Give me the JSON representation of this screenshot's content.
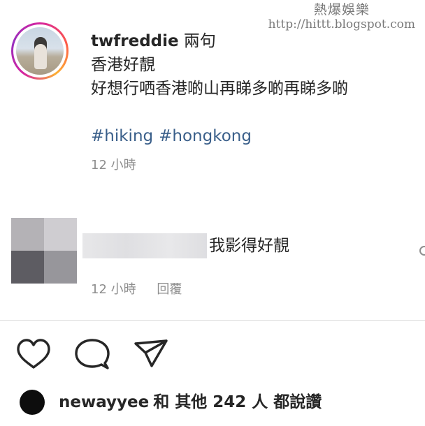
{
  "watermark": {
    "title": "熱爆娛樂",
    "url": "http://hittt.blogspot.com"
  },
  "post": {
    "username": "twfreddie",
    "caption_intro": "兩句",
    "caption_lines": [
      "香港好靚",
      "好想行哂香港啲山再睇多啲再睇多啲"
    ],
    "hashtags": [
      "#hiking",
      "#hongkong"
    ],
    "time": "12 小時"
  },
  "comment": {
    "text": "我影得好靚",
    "time": "12 小時",
    "reply_label": "回覆",
    "avatar_colors": [
      "#b4b2b6",
      "#cfcdd1",
      "#5d5c62",
      "#97969b"
    ]
  },
  "actions": {
    "icons": [
      "heart-icon",
      "comment-icon",
      "share-icon"
    ]
  },
  "likes": {
    "liker": "newayyee",
    "rest": "和 其他 242 人 都說讚"
  },
  "colors": {
    "hashtag": "#3a5f8a",
    "muted": "#8e8e8e",
    "text": "#262626"
  }
}
